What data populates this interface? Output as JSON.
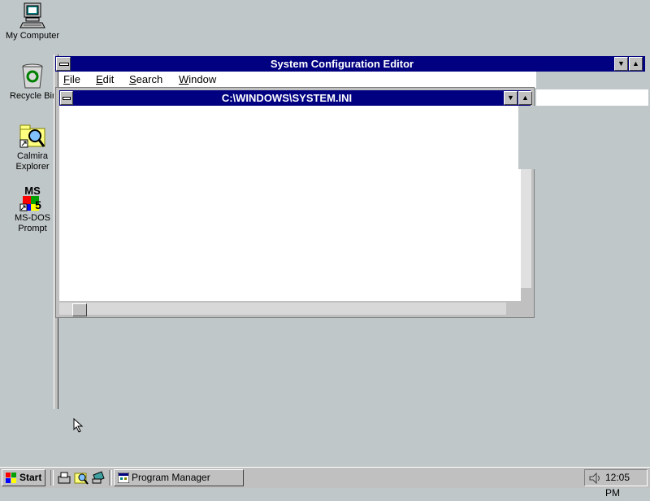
{
  "desktop": {
    "icons": [
      {
        "label": "My Computer",
        "icon": "computer-icon"
      },
      {
        "label": "Recycle Bin",
        "icon": "recycle-bin-icon"
      },
      {
        "label": "Calmira\nExplorer",
        "icon": "explorer-icon"
      },
      {
        "label": "MS-DOS\nPrompt",
        "icon": "msdos-icon"
      }
    ]
  },
  "main_window": {
    "title": "System Configuration Editor",
    "menu": [
      {
        "label": "File",
        "accel": "F",
        "rest": "ile"
      },
      {
        "label": "Edit",
        "accel": "E",
        "rest": "dit"
      },
      {
        "label": "Search",
        "accel": "S",
        "rest": "earch"
      },
      {
        "label": "Window",
        "accel": "W",
        "rest": "indow"
      }
    ]
  },
  "child_window": {
    "title": "C:\\WINDOWS\\SYSTEM.INI"
  },
  "taskbar": {
    "start_label": "Start",
    "tasks": [
      {
        "label": "Program Manager"
      }
    ],
    "clock": "12:05 PM"
  },
  "colors": {
    "desktop": "#c0c7c8",
    "title_bar": "#000080",
    "face": "#c0c0c0"
  }
}
